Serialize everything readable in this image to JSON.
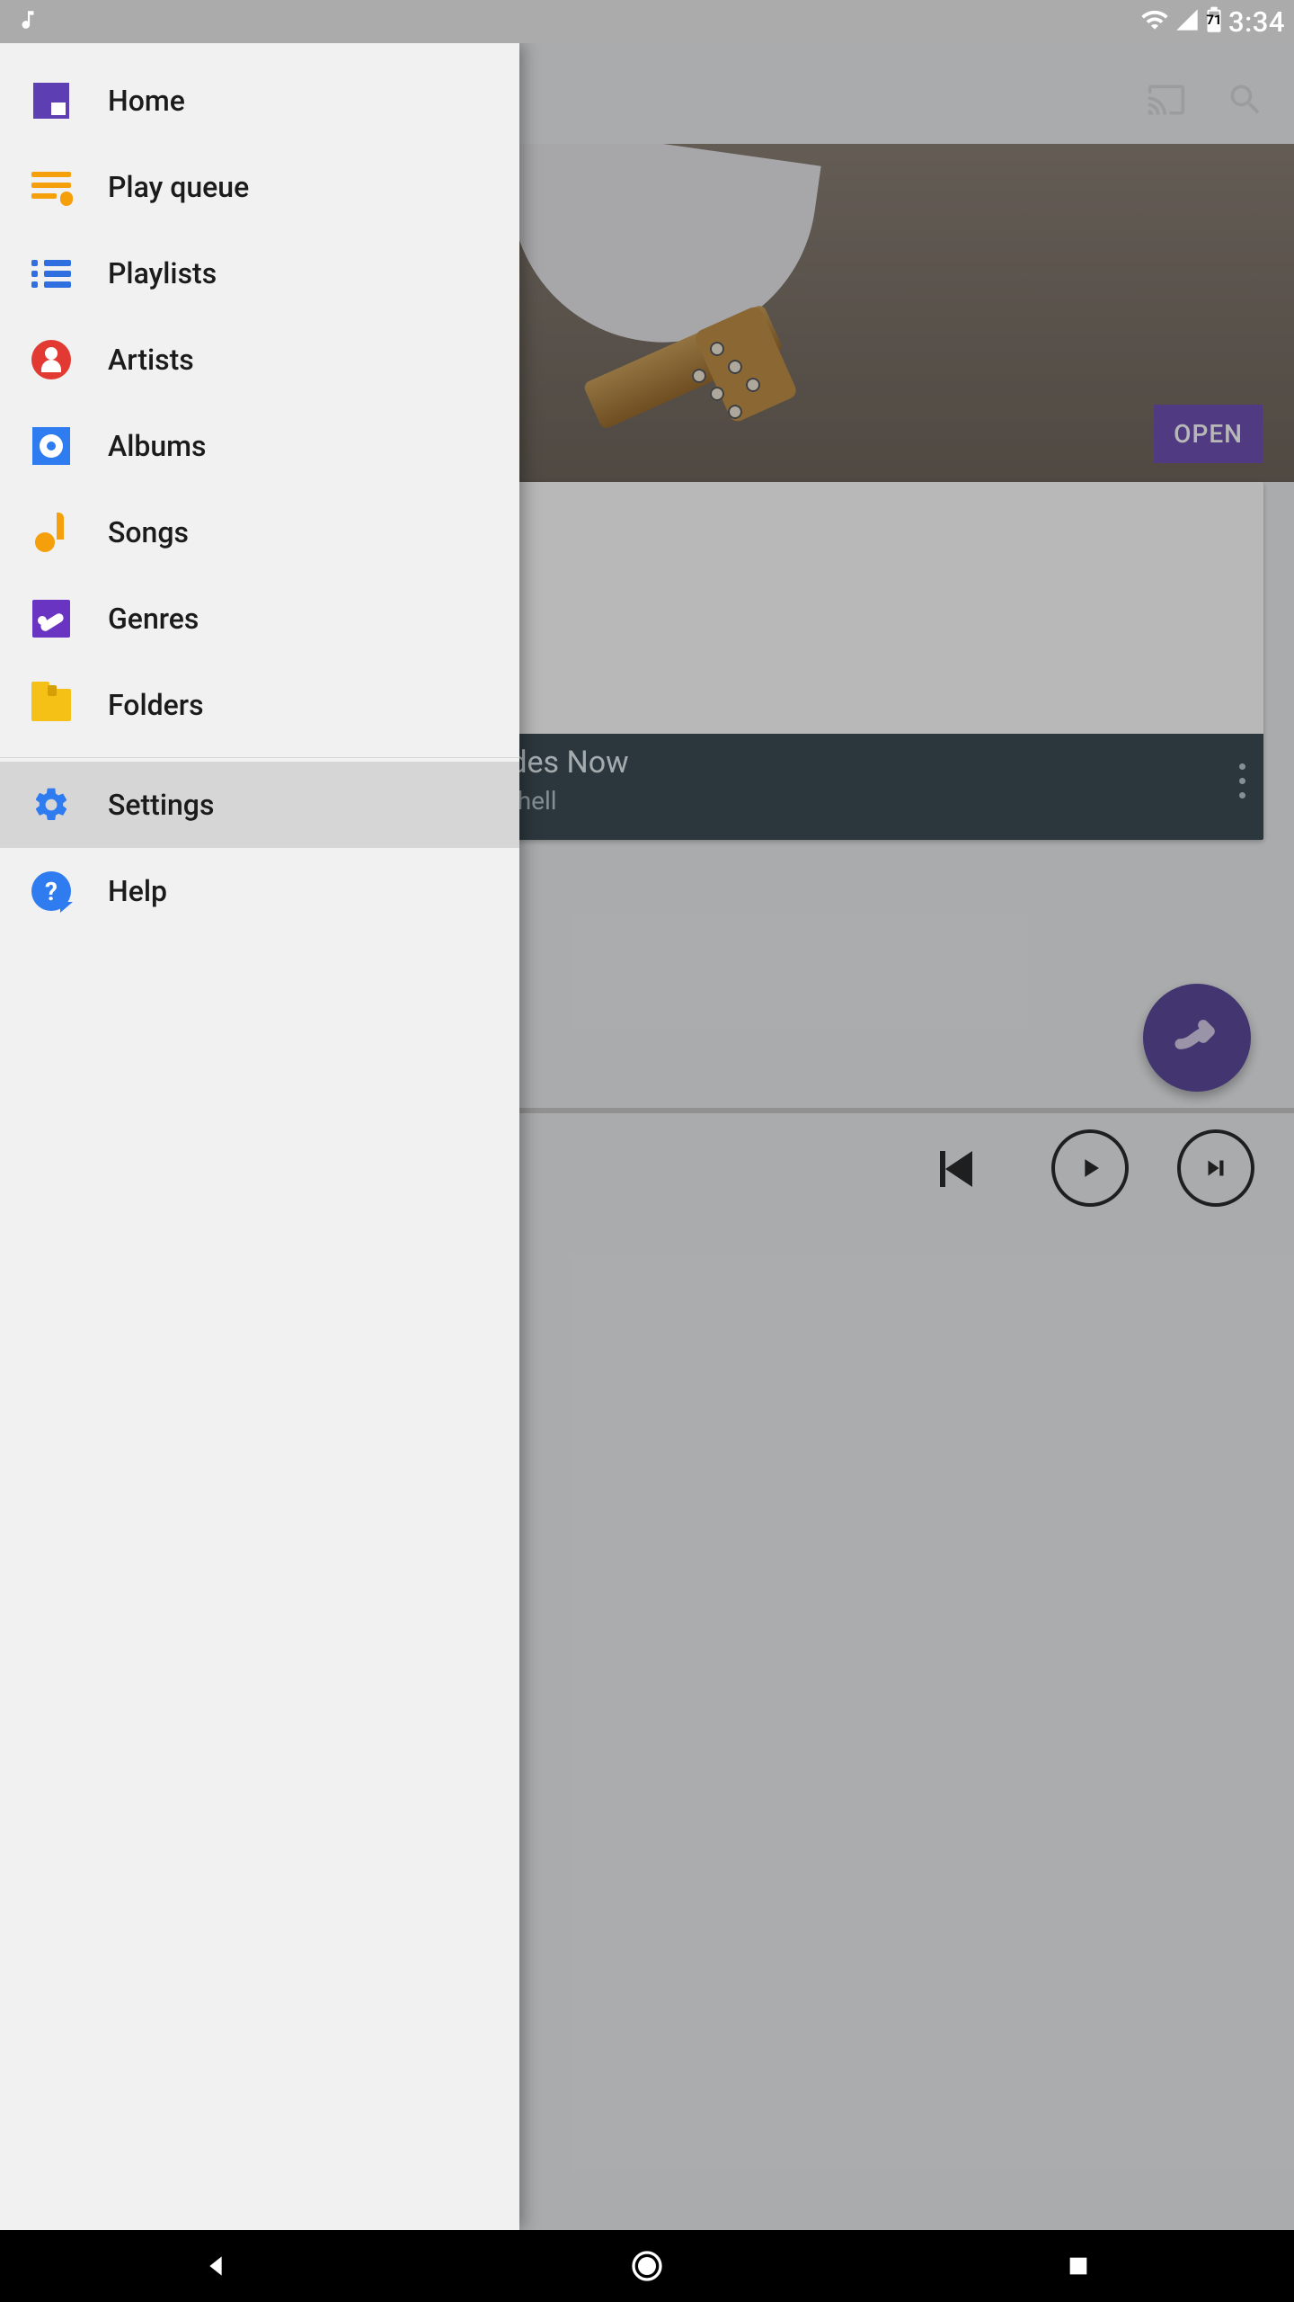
{
  "status": {
    "time": "3:34",
    "battery_pct": "71"
  },
  "drawer": {
    "items": [
      {
        "label": "Home"
      },
      {
        "label": "Play queue"
      },
      {
        "label": "Playlists"
      },
      {
        "label": "Artists"
      },
      {
        "label": "Albums"
      },
      {
        "label": "Songs"
      },
      {
        "label": "Genres"
      },
      {
        "label": "Folders"
      }
    ],
    "secondary": [
      {
        "label": "Settings",
        "selected": true
      },
      {
        "label": "Help"
      }
    ]
  },
  "hero": {
    "open_label": "OPEN"
  },
  "now_playing": {
    "title": "Both Sides Now",
    "artist": "Joni Mitchell"
  }
}
